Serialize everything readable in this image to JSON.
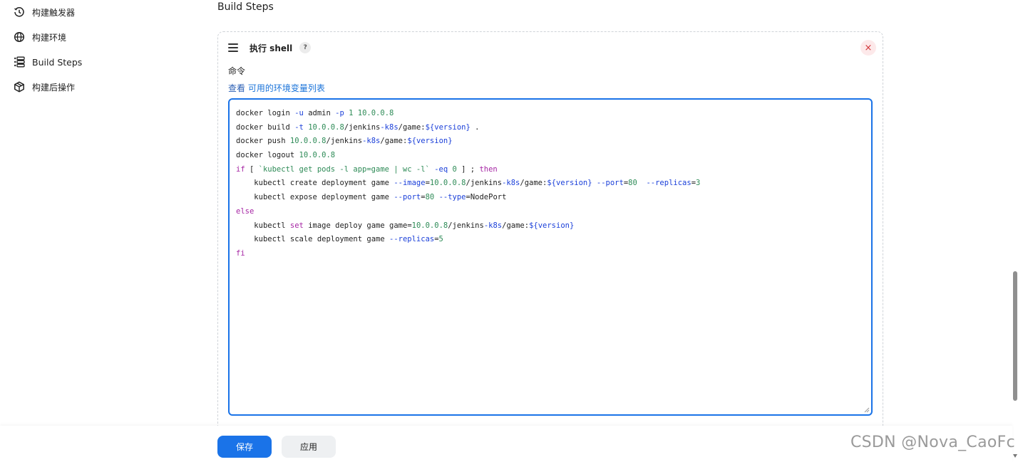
{
  "sidebar": {
    "items": [
      {
        "label": "构建触发器",
        "icon": "clock-refresh-icon"
      },
      {
        "label": "构建环境",
        "icon": "globe-icon"
      },
      {
        "label": "Build Steps",
        "icon": "list-icon"
      },
      {
        "label": "构建后操作",
        "icon": "package-icon"
      }
    ]
  },
  "section": {
    "title": "Build Steps"
  },
  "step": {
    "title": "执行 shell",
    "help": "?",
    "close": "×",
    "command_label": "命令",
    "env_prefix": "查看 ",
    "env_link": "可用的环境变量列表"
  },
  "code": {
    "lines": [
      "docker login -u admin -p 1 10.0.0.8",
      "docker build -t 10.0.0.8/jenkins-k8s/game:${version} .",
      "docker push 10.0.0.8/jenkins-k8s/game:${version}",
      "docker logout 10.0.0.8",
      "if [ `kubectl get pods -l app=game | wc -l` -eq 0 ] ; then",
      "    kubectl create deployment game --image=10.0.0.8/jenkins-k8s/game:${version} --port=80  --replicas=3",
      "    kubectl expose deployment game --port=80 --type=NodePort",
      "else",
      "    kubectl set image deploy game game=10.0.0.8/jenkins-k8s/game:${version}",
      "    kubectl scale deployment game --replicas=5",
      "fi"
    ]
  },
  "footer": {
    "save_label": "保存",
    "apply_label": "应用"
  },
  "watermark": "CSDN @Nova_CaoFc",
  "colors": {
    "accent": "#1a73e8",
    "keyword": "#a626a4",
    "number": "#2e8b57",
    "variable": "#1a3fd9",
    "danger": "#d13438"
  }
}
